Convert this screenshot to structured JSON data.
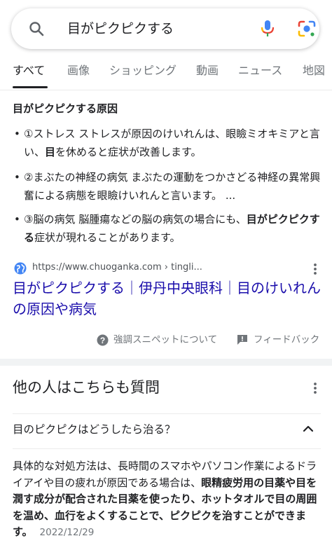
{
  "search": {
    "query": "目がピクピクする"
  },
  "tabs": [
    {
      "label": "すべて"
    },
    {
      "label": "画像"
    },
    {
      "label": "ショッピング"
    },
    {
      "label": "動画"
    },
    {
      "label": "ニュース"
    },
    {
      "label": "地図"
    }
  ],
  "snippet": {
    "title": "目がピクピクする原因",
    "bullets": [
      {
        "marker": "•",
        "pre": "①ストレス ストレスが原因のけいれんは、眼瞼ミオキミアと言い、",
        "bold": "目",
        "post": "を休めると症状が改善します。"
      },
      {
        "marker": "•",
        "pre": "②まぶたの神経の病気 まぶたの運動をつかさどる神経の異常興奮による病態を眼瞼けいれんと言います。 ...",
        "bold": "",
        "post": ""
      },
      {
        "marker": "•",
        "pre": "③脳の病気 脳腫瘍などの脳の病気の場合にも、",
        "bold": "目がピクピクする",
        "post": "症状が現れることがあります。"
      }
    ]
  },
  "result": {
    "url": "https://www.chuoganka.com › tingli...",
    "title": "目がピクピクする｜伊丹中央眼科｜目のけいれんの原因や病気",
    "featured_label": "強調スニペットについて",
    "feedback_label": "フィードバック"
  },
  "paa": {
    "title": "他の人はこちらも質問",
    "question": "目のピクピクはどうしたら治る？",
    "answer_pre": "具体的な対処方法は、長時間のスマホやパソコン作業によるドライアイや目の疲れが原因である場合は、",
    "answer_bold": "眼精疲労用の目薬や目を潤す成分が配合された目薬を使ったり、ホットタオルで目の周囲を温め、血行をよくすることで、ピクピクを治すことができます。",
    "date": "2022/12/29"
  },
  "colors": {
    "link": "#1a0dab",
    "text": "#202124",
    "muted": "#70757a",
    "google_blue": "#4285f4",
    "google_red": "#ea4335",
    "google_yellow": "#fbbc04",
    "google_green": "#34a853"
  }
}
